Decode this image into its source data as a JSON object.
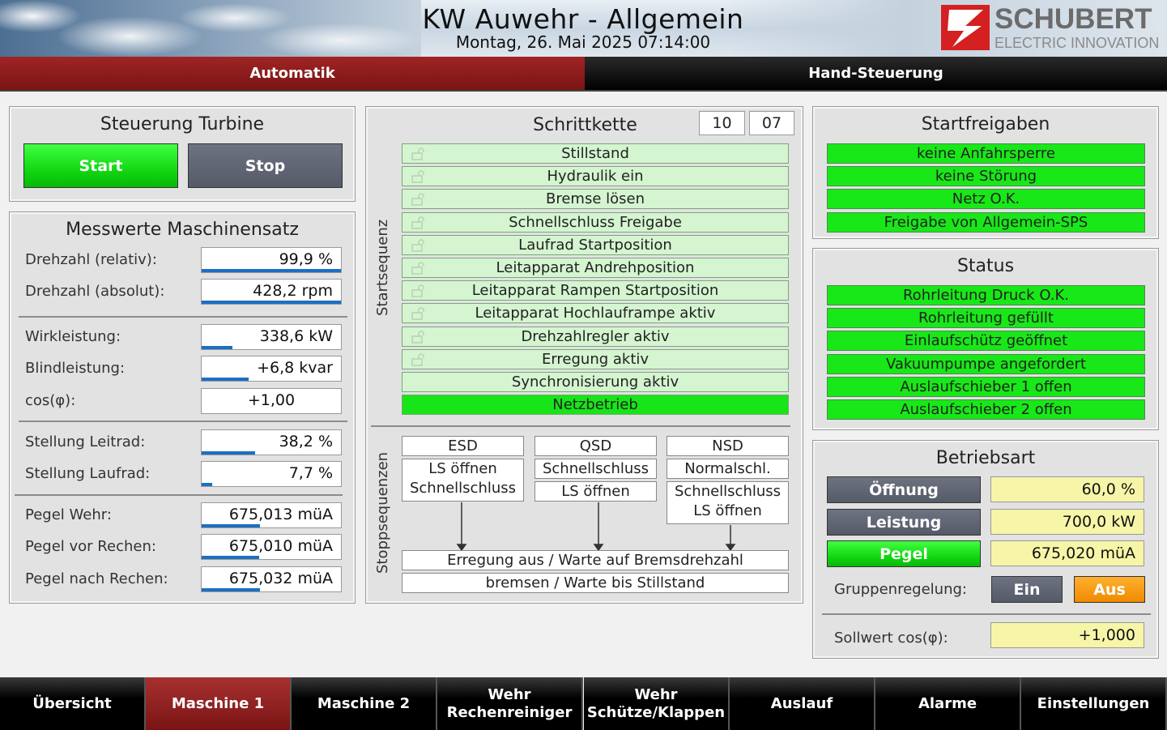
{
  "header": {
    "title": "KW Auwehr - Allgemein",
    "datetime": "Montag, 26. Mai 2025 07:14:00",
    "logo_name": "SCHUBERT",
    "logo_sub": "ELECTRIC INNOVATION"
  },
  "modes": {
    "auto": "Automatik",
    "hand": "Hand-Steuerung",
    "active": "Automatik"
  },
  "turbine": {
    "title": "Steuerung Turbine",
    "start": "Start",
    "stop": "Stop"
  },
  "messwerte": {
    "title": "Messwerte Maschinensatz",
    "rows": [
      {
        "label": "Drehzahl (relativ):",
        "value": "99,9 %",
        "fill": 0.999
      },
      {
        "label": "Drehzahl (absolut):",
        "value": "428,2 rpm",
        "fill": 1.0
      },
      {
        "label": "Wirkleistung:",
        "value": "338,6 kW",
        "fill": 0.22
      },
      {
        "label": "Blindleistung:",
        "value": "+6,8 kvar",
        "fill": 0.34
      },
      {
        "label": "cos(φ):",
        "value": "+1,00"
      },
      {
        "label": "Stellung Leitrad:",
        "value": "38,2 %",
        "fill": 0.382
      },
      {
        "label": "Stellung Laufrad:",
        "value": "7,7 %",
        "fill": 0.077
      },
      {
        "label": "Pegel Wehr:",
        "value": "675,013 müA",
        "fill": 0.42
      },
      {
        "label": "Pegel vor Rechen:",
        "value": "675,010 müA",
        "fill": 0.41
      },
      {
        "label": "Pegel nach Rechen:",
        "value": "675,032 müA",
        "fill": 0.42
      }
    ]
  },
  "schrittkette": {
    "title": "Schrittkette",
    "counter1": "10",
    "counter2": "07",
    "startsequenz_label": "Startsequenz",
    "stoppsequenzen_label": "Stoppsequenzen",
    "steps": [
      {
        "label": "Stillstand",
        "lock": true
      },
      {
        "label": "Hydraulik ein",
        "lock": true
      },
      {
        "label": "Bremse lösen",
        "lock": true
      },
      {
        "label": "Schnellschluss Freigabe",
        "lock": true
      },
      {
        "label": "Laufrad Startposition",
        "lock": true
      },
      {
        "label": "Leitapparat Andrehposition",
        "lock": true
      },
      {
        "label": "Leitapparat Rampen Startposition",
        "lock": true
      },
      {
        "label": "Leitapparat Hochlauframpe aktiv",
        "lock": true
      },
      {
        "label": "Drehzahlregler aktiv",
        "lock": true
      },
      {
        "label": "Erregung aktiv",
        "lock": true
      },
      {
        "label": "Synchronisierung aktiv",
        "lock": false
      },
      {
        "label": "Netzbetrieb",
        "lock": false,
        "active": true
      }
    ],
    "stop": {
      "esd": {
        "head": "ESD",
        "body": "LS öffnen\nSchnellschluss"
      },
      "qsd": {
        "head": "QSD",
        "row1": "Schnellschluss",
        "row2": "LS öffnen"
      },
      "nsd": {
        "head": "NSD",
        "row1": "Normalschl.",
        "row2": "Schnellschluss\nLS öffnen"
      },
      "common1": "Erregung aus / Warte auf Bremsdrehzahl",
      "common2": "bremsen / Warte bis Stillstand"
    }
  },
  "startfreigaben": {
    "title": "Startfreigaben",
    "items": [
      "keine Anfahrsperre",
      "keine Störung",
      "Netz O.K.",
      "Freigabe von Allgemein-SPS"
    ]
  },
  "status": {
    "title": "Status",
    "items": [
      "Rohrleitung Druck O.K.",
      "Rohrleitung gefüllt",
      "Einlaufschütz geöffnet",
      "Vakuumpumpe angefordert",
      "Auslaufschieber 1 offen",
      "Auslaufschieber 2 offen"
    ]
  },
  "betriebsart": {
    "title": "Betriebsart",
    "modes": [
      {
        "label": "Öffnung",
        "value": "60,0 %",
        "active": false
      },
      {
        "label": "Leistung",
        "value": "700,0 kW",
        "active": false
      },
      {
        "label": "Pegel",
        "value": "675,020 müA",
        "active": true
      }
    ],
    "gruppen_label": "Gruppenregelung:",
    "gruppen_ein": "Ein",
    "gruppen_aus": "Aus",
    "gruppen_selected": "Aus",
    "sollwert_label": "Sollwert cos(φ):",
    "sollwert_value": "+1,000"
  },
  "nav": {
    "items": [
      "Übersicht",
      "Maschine 1",
      "Maschine 2",
      "Wehr\nRechenreiniger",
      "Wehr\nSchütze/Klappen",
      "Auslauf",
      "Alarme",
      "Einstellungen"
    ],
    "active": "Maschine 1"
  },
  "colors": {
    "accent_red": "#8b1a1a",
    "status_green": "#18e818",
    "value_yellow": "#f7f5a8",
    "bar_blue": "#1c6fc4",
    "aus_orange": "#ff9d00"
  }
}
